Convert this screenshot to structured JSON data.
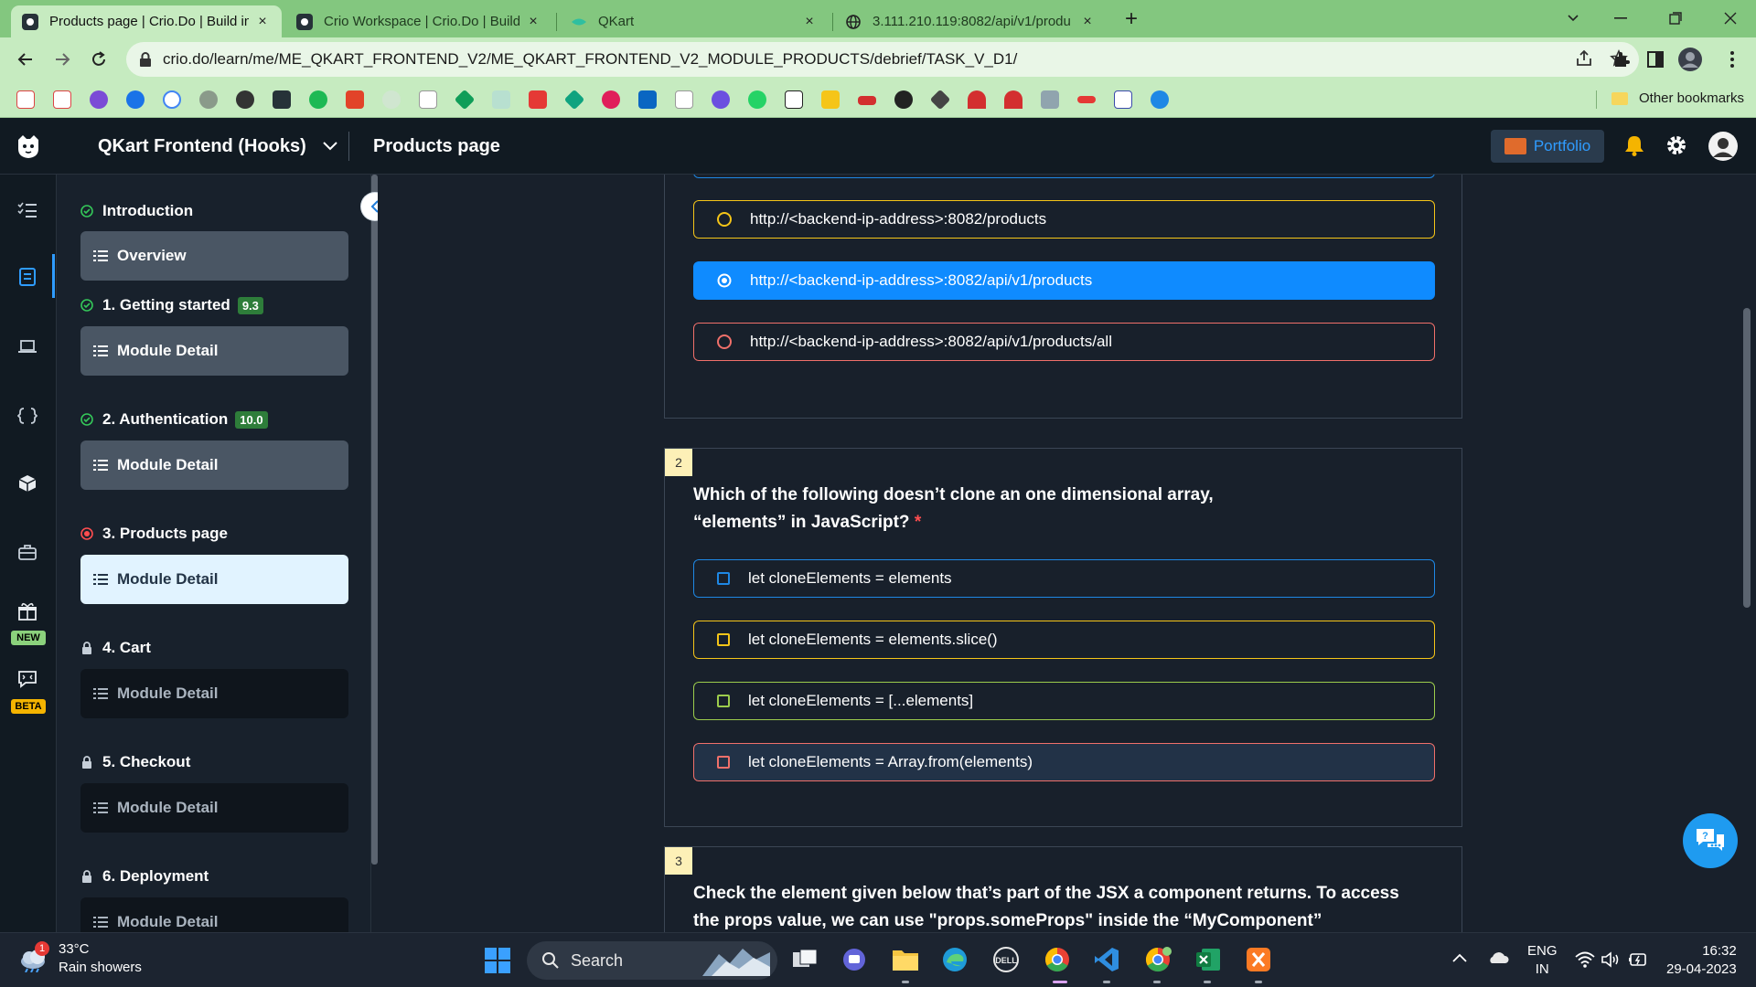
{
  "browser": {
    "tabs": [
      {
        "title": "Products page | Crio.Do | Build in",
        "close": "×"
      },
      {
        "title": "Crio Workspace | Crio.Do | Build i",
        "close": "×"
      },
      {
        "title": "QKart",
        "close": "×"
      },
      {
        "title": "3.111.210.119:8082/api/v1/produ",
        "close": "×"
      }
    ],
    "new_tab": "+",
    "url": "crio.do/learn/me/ME_QKART_FRONTEND_V2/ME_QKART_FRONTEND_V2_MODULE_PRODUCTS/debrief/TASK_V_D1/",
    "other_bookmarks": "Other bookmarks"
  },
  "header": {
    "course_title": "QKart Frontend (Hooks)",
    "page_title": "Products page",
    "portfolio_label": "Portfolio"
  },
  "rail": {
    "new_badge": "NEW",
    "beta_badge": "BETA"
  },
  "sidebar": {
    "modules": [
      {
        "title": "Introduction",
        "status": "done",
        "score": "",
        "item": "Overview"
      },
      {
        "title": "1. Getting started",
        "status": "done",
        "score": "9.3",
        "item": "Module Detail"
      },
      {
        "title": "2. Authentication",
        "status": "done",
        "score": "10.0",
        "item": "Module Detail"
      },
      {
        "title": "3. Products page",
        "status": "current",
        "score": "",
        "item": "Module Detail"
      },
      {
        "title": "4. Cart",
        "status": "locked",
        "score": "",
        "item": "Module Detail"
      },
      {
        "title": "5. Checkout",
        "status": "locked",
        "score": "",
        "item": "Module Detail"
      },
      {
        "title": "6. Deployment",
        "status": "locked",
        "score": "",
        "item": "Module Detail"
      }
    ]
  },
  "questions": [
    {
      "options": [
        {
          "text": "http://<backend-ip-address>:8082/products",
          "color": "#f5c518",
          "selected": false
        },
        {
          "text": "http://<backend-ip-address>:8082/api/v1/products",
          "color": "#0f8bff",
          "selected": true
        },
        {
          "text": "http://<backend-ip-address>:8082/api/v1/products/all",
          "color": "#f0706a",
          "selected": false
        }
      ]
    },
    {
      "number": "2",
      "text": "Which of the following doesn’t clone an one dimensional array, “elements” in JavaScript?",
      "required_mark": "*",
      "options": [
        {
          "text": "let cloneElements = elements",
          "color": "#1e88e5"
        },
        {
          "text": "let cloneElements = elements.slice()",
          "color": "#f5c518"
        },
        {
          "text": "let cloneElements = [...elements]",
          "color": "#9ccc4c"
        },
        {
          "text": "let cloneElements = Array.from(elements)",
          "color": "#f0706a"
        }
      ]
    },
    {
      "number": "3",
      "text_line1": "Check the element given below that’s part of the JSX a component returns. To access",
      "text_line2": "the props value, we can use \"props.someProps\" inside the “MyComponent”"
    }
  ],
  "taskbar": {
    "weather_temp": "33°C",
    "weather_desc": "Rain showers",
    "weather_alert": "1",
    "search_label": "Search",
    "lang_line1": "ENG",
    "lang_line2": "IN",
    "time": "16:32",
    "date": "29-04-2023"
  },
  "colors": {
    "accent": "#0f8bff",
    "app_bg": "#18202b",
    "header_bg": "#111a22",
    "browser_frame": "#c6ebc0"
  }
}
